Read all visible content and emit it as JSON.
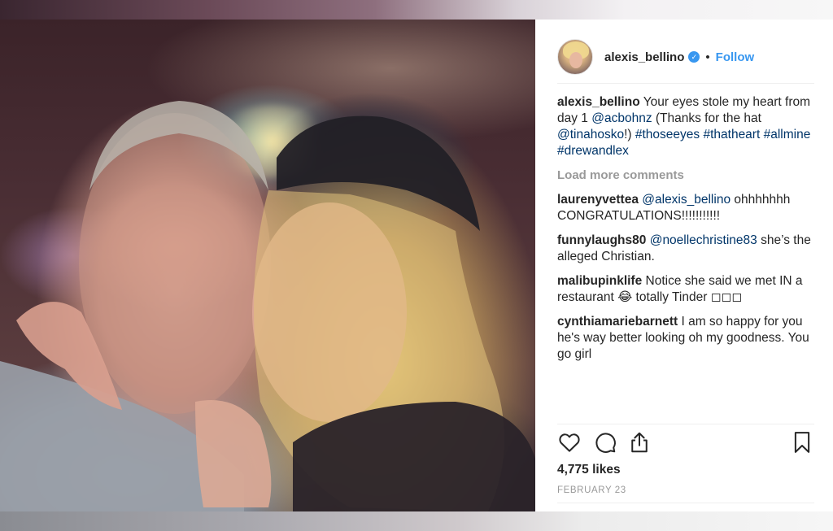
{
  "post": {
    "username": "alexis_bellino",
    "verified_icon": "verified-badge-icon",
    "dot": "•",
    "follow_label": "Follow",
    "caption": {
      "username": "alexis_bellino",
      "text_1": "Your eyes stole my heart from day 1 ",
      "mention_1": "@acbohnz",
      "text_2": " (Thanks for the hat ",
      "mention_2": "@tinahosko",
      "text_3": "!) ",
      "hashtag_1": "#thoseeyes",
      "hashtag_2": "#thatheart",
      "hashtag_3": "#allmine",
      "hashtag_4": "#drewandlex"
    },
    "load_more_label": "Load more comments",
    "comments": [
      {
        "user": "laurenyvettea",
        "mention": "@alexis_bellino",
        "text": " ohhhhhhh CONGRATULATIONS!!!!!!!!!!!"
      },
      {
        "user": "funnylaughs80",
        "mention": "@noellechristine83",
        "text": " she’s the alleged Christian."
      },
      {
        "user": "malibupinklife",
        "mention": "",
        "text": " Notice she said we met IN a restaurant 😂 totally Tinder ◻◻◻"
      },
      {
        "user": "cynthiamariebarnett",
        "mention": "",
        "text": " I am so happy for you he's way better looking oh my goodness. You go girl"
      }
    ],
    "likes": "4,775 likes",
    "date": "FEBRUARY 23",
    "icons": {
      "like": "heart-icon",
      "comment": "comment-bubble-icon",
      "share": "share-icon",
      "save": "bookmark-icon"
    },
    "colors": {
      "link": "#003569",
      "follow": "#3897f0",
      "muted": "#999999",
      "text": "#262626"
    }
  }
}
